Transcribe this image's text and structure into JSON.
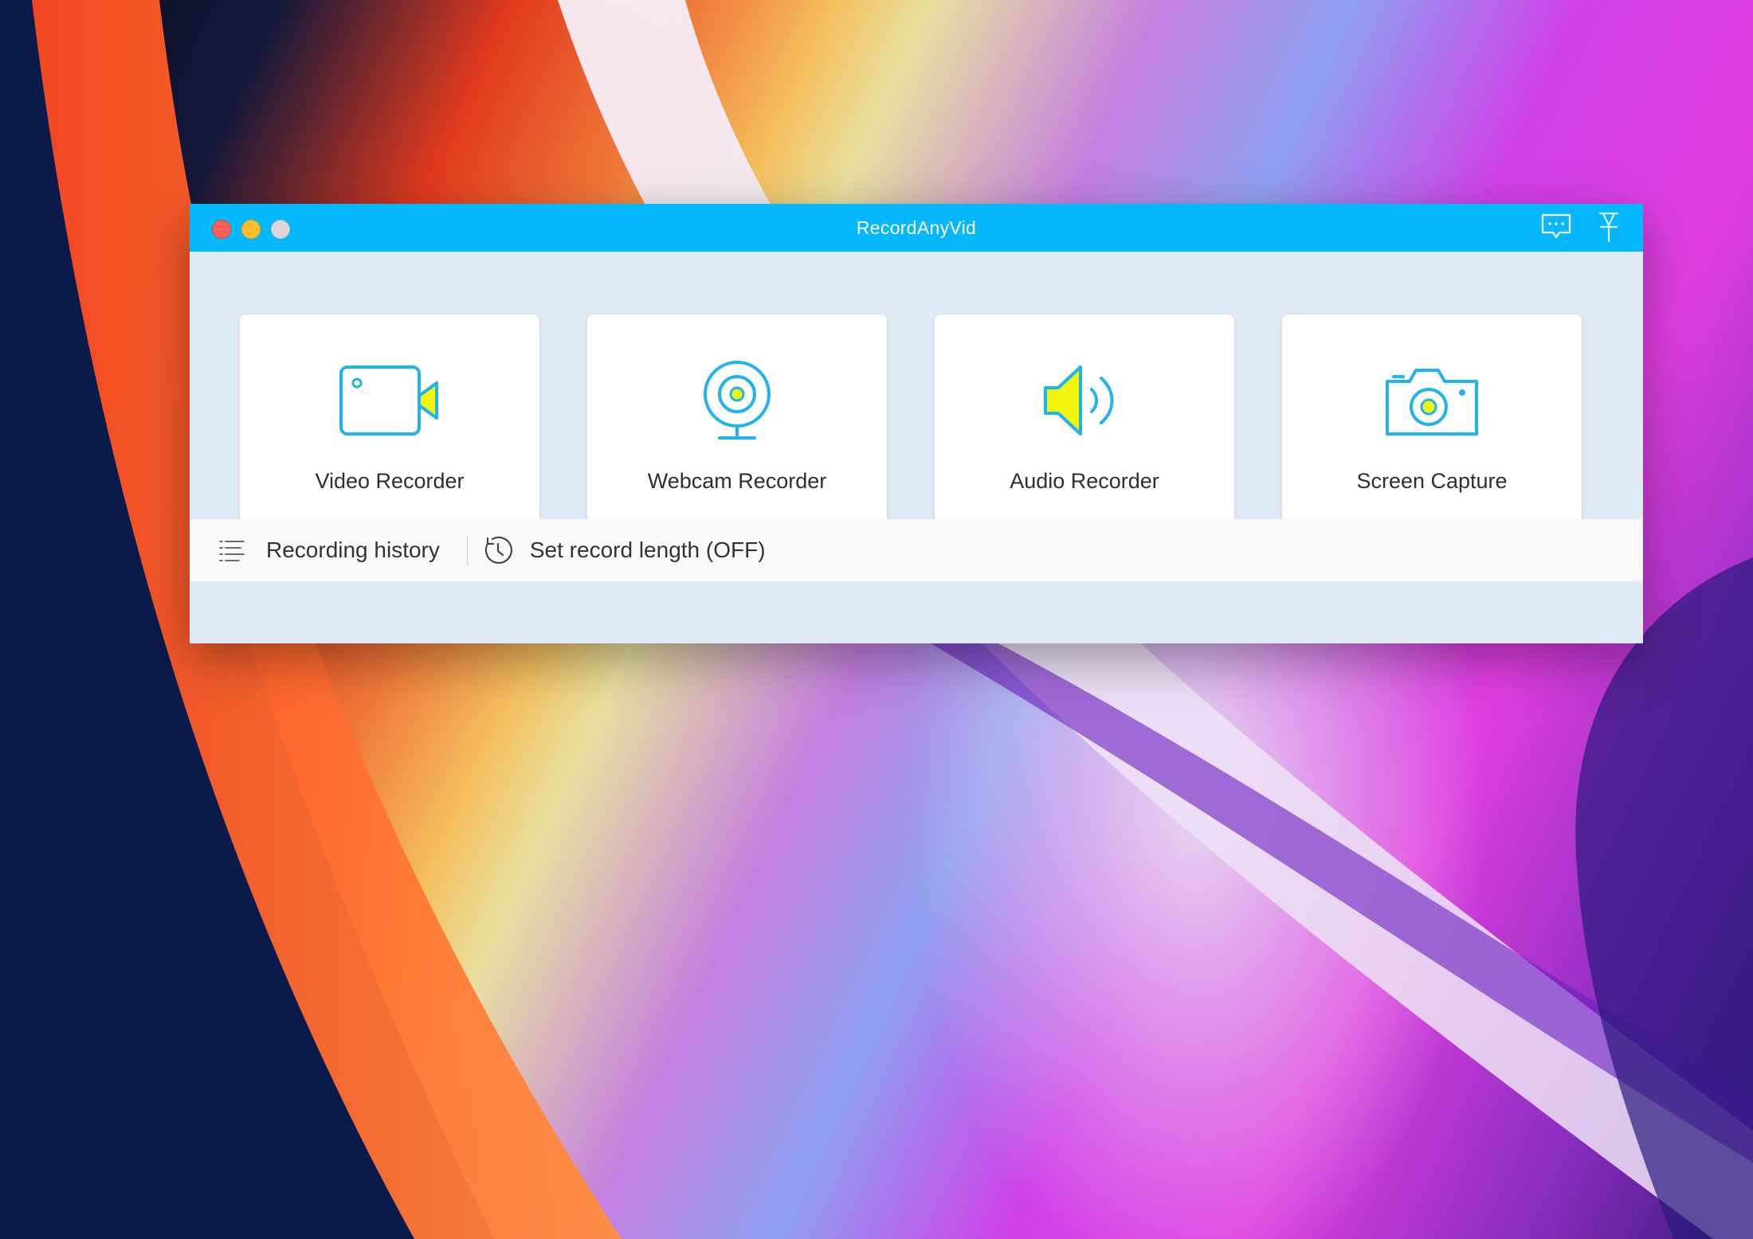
{
  "window": {
    "title": "RecordAnyVid"
  },
  "titlebar_actions": [
    {
      "name": "feedback-icon"
    },
    {
      "name": "pin-icon"
    }
  ],
  "cards": [
    {
      "label": "Video Recorder",
      "icon": "video-camera-icon"
    },
    {
      "label": "Webcam Recorder",
      "icon": "webcam-icon"
    },
    {
      "label": "Audio Recorder",
      "icon": "speaker-icon"
    },
    {
      "label": "Screen Capture",
      "icon": "camera-icon"
    }
  ],
  "footer": {
    "history_label": "Recording history",
    "record_length_label": "Set record length (OFF)"
  },
  "colors": {
    "titlebar": "#05b8fd",
    "icon_stroke": "#1fb3ef",
    "icon_fill": "#f1f50a",
    "content_bg": "#dfeaf6"
  }
}
